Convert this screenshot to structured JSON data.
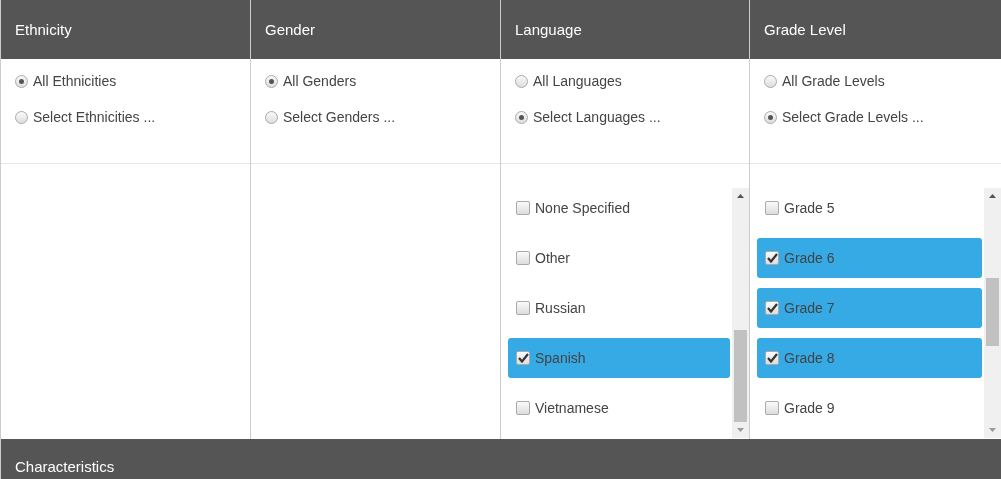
{
  "columns": [
    {
      "title": "Ethnicity",
      "options": [
        {
          "label": "All Ethnicities",
          "selected": true
        },
        {
          "label": "Select Ethnicities ...",
          "selected": false
        }
      ]
    },
    {
      "title": "Gender",
      "options": [
        {
          "label": "All Genders",
          "selected": true
        },
        {
          "label": "Select Genders ...",
          "selected": false
        }
      ]
    },
    {
      "title": "Language",
      "options": [
        {
          "label": "All Languages",
          "selected": false
        },
        {
          "label": "Select Languages ...",
          "selected": true
        }
      ],
      "list": [
        {
          "label": "None Specified",
          "checked": false
        },
        {
          "label": "Other",
          "checked": false
        },
        {
          "label": "Russian",
          "checked": false
        },
        {
          "label": "Spanish",
          "checked": true
        },
        {
          "label": "Vietnamese",
          "checked": false
        }
      ]
    },
    {
      "title": "Grade Level",
      "options": [
        {
          "label": "All Grade Levels",
          "selected": false
        },
        {
          "label": "Select Grade Levels ...",
          "selected": true
        }
      ],
      "list": [
        {
          "label": "Grade 5",
          "checked": false
        },
        {
          "label": "Grade 6",
          "checked": true
        },
        {
          "label": "Grade 7",
          "checked": true
        },
        {
          "label": "Grade 8",
          "checked": true
        },
        {
          "label": "Grade 9",
          "checked": false
        }
      ]
    }
  ],
  "section": {
    "title": "Characteristics"
  }
}
